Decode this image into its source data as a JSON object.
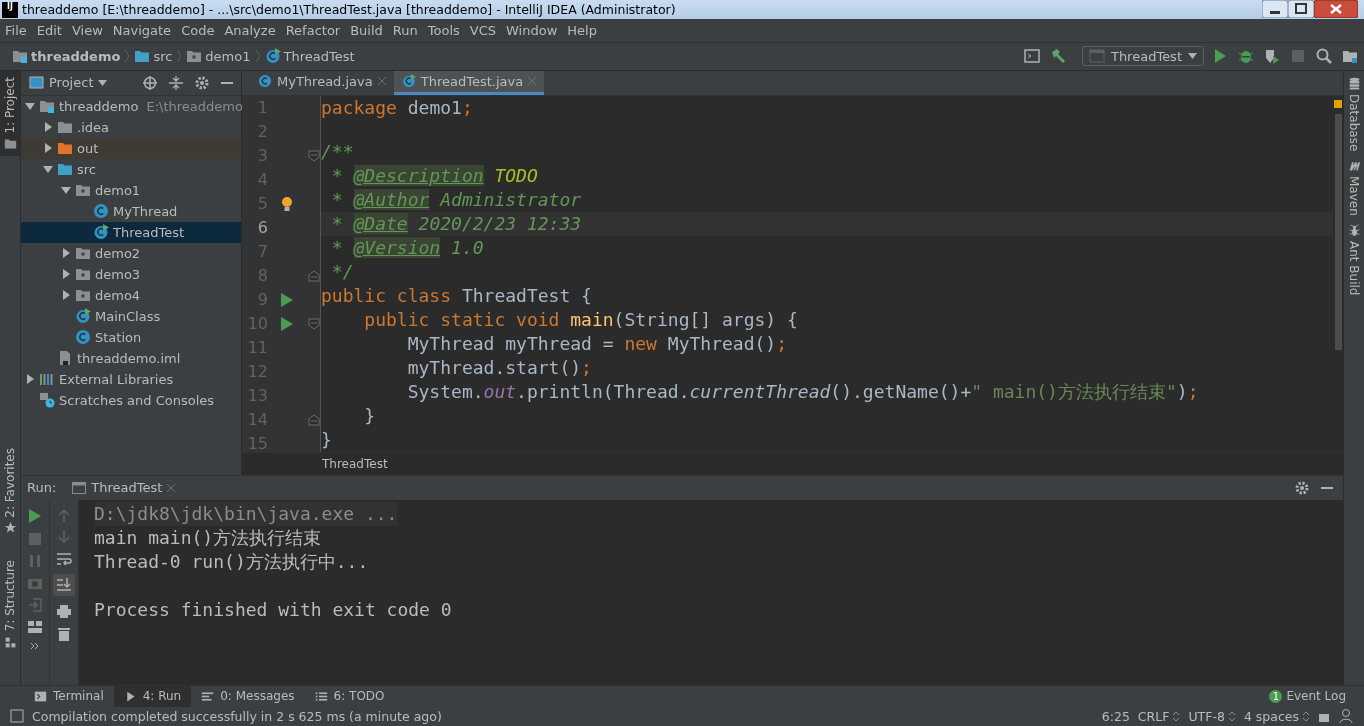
{
  "window": {
    "title": "threaddemo [E:\\threaddemo] - ...\\src\\demo1\\ThreadTest.java [threaddemo] - IntelliJ IDEA (Administrator)",
    "app_icon": "IJ"
  },
  "menu": [
    "File",
    "Edit",
    "View",
    "Navigate",
    "Code",
    "Analyze",
    "Refactor",
    "Build",
    "Run",
    "Tools",
    "VCS",
    "Window",
    "Help"
  ],
  "breadcrumbs": [
    {
      "label": "threaddemo",
      "kind": "module"
    },
    {
      "label": "src",
      "kind": "source-folder"
    },
    {
      "label": "demo1",
      "kind": "package"
    },
    {
      "label": "ThreadTest",
      "kind": "runnable-class"
    }
  ],
  "run_config": "ThreadTest",
  "left_stripe": {
    "top": [
      {
        "label": "1: Project",
        "kind": "folder",
        "selected": true
      }
    ],
    "bottom": [
      {
        "label": "2: Favorites",
        "kind": "star",
        "selected": false
      },
      {
        "label": "7: Structure",
        "kind": "structure",
        "selected": false
      }
    ]
  },
  "project_panel": {
    "title": "Project",
    "tree": [
      {
        "label": "threaddemo",
        "path": "E:\\threaddemo",
        "kind": "module",
        "expanded": true,
        "selected": false,
        "children": [
          {
            "label": ".idea",
            "kind": "folder",
            "expanded": false,
            "selected": false
          },
          {
            "label": "out",
            "kind": "excluded-folder",
            "expanded": false,
            "selected": false
          },
          {
            "label": "src",
            "kind": "source-folder",
            "expanded": true,
            "selected": false,
            "children": [
              {
                "label": "demo1",
                "kind": "package",
                "expanded": true,
                "selected": false,
                "children": [
                  {
                    "label": "MyThread",
                    "kind": "class",
                    "selected": false
                  },
                  {
                    "label": "ThreadTest",
                    "kind": "runnable-class",
                    "selected": true
                  }
                ]
              },
              {
                "label": "demo2",
                "kind": "package",
                "expanded": false,
                "selected": false
              },
              {
                "label": "demo3",
                "kind": "package",
                "expanded": false,
                "selected": false
              },
              {
                "label": "demo4",
                "kind": "package",
                "expanded": false,
                "selected": false
              },
              {
                "label": "MainClass",
                "kind": "runnable-class",
                "selected": false
              },
              {
                "label": "Station",
                "kind": "class",
                "selected": false
              }
            ]
          },
          {
            "label": "threaddemo.iml",
            "kind": "iml",
            "selected": false
          }
        ]
      },
      {
        "label": "External Libraries",
        "kind": "libraries",
        "expanded": false,
        "selected": false
      },
      {
        "label": "Scratches and Consoles",
        "kind": "scratches",
        "selected": false
      }
    ]
  },
  "editor": {
    "tabs": [
      {
        "label": "MyThread.java",
        "kind": "class",
        "selected": false
      },
      {
        "label": "ThreadTest.java",
        "kind": "runnable-class",
        "selected": true
      }
    ],
    "lines": [
      {
        "number": "1",
        "current": false,
        "run_marker": false,
        "bulb": false,
        "fold_start": false,
        "fold_end": false,
        "tokens": [
          {
            "kind": "keyword",
            "text": "package "
          },
          {
            "kind": "text",
            "text": "demo1"
          },
          {
            "kind": "keyword",
            "text": ";"
          }
        ]
      },
      {
        "number": "2",
        "current": false,
        "run_marker": false,
        "bulb": false,
        "fold_start": false,
        "fold_end": false
      },
      {
        "number": "3",
        "current": false,
        "run_marker": false,
        "bulb": false,
        "fold_start": true,
        "fold_end": false,
        "tokens": [
          {
            "kind": "doc",
            "text": "/**"
          }
        ]
      },
      {
        "number": "4",
        "current": false,
        "run_marker": false,
        "bulb": false,
        "fold_start": false,
        "fold_end": false,
        "tokens": [
          {
            "kind": "doc",
            "text": " * "
          },
          {
            "kind": "doc-tag",
            "text": "@Description"
          },
          {
            "kind": "todo",
            "text": " TODO"
          }
        ]
      },
      {
        "number": "5",
        "current": false,
        "run_marker": false,
        "bulb": true,
        "fold_start": false,
        "fold_end": false,
        "tokens": [
          {
            "kind": "doc",
            "text": " * "
          },
          {
            "kind": "doc-tag",
            "text": "@Author"
          },
          {
            "kind": "doc",
            "text": " Administrator"
          }
        ]
      },
      {
        "number": "6",
        "current": true,
        "run_marker": false,
        "bulb": false,
        "fold_start": false,
        "fold_end": false,
        "tokens": [
          {
            "kind": "doc",
            "text": " * "
          },
          {
            "kind": "doc-tag",
            "text": "@Date"
          },
          {
            "kind": "doc",
            "text": " 2020/2/23 12:33"
          }
        ]
      },
      {
        "number": "7",
        "current": false,
        "run_marker": false,
        "bulb": false,
        "fold_start": false,
        "fold_end": false,
        "tokens": [
          {
            "kind": "doc",
            "text": " * "
          },
          {
            "kind": "doc-tag",
            "text": "@Version"
          },
          {
            "kind": "doc",
            "text": " 1.0"
          }
        ]
      },
      {
        "number": "8",
        "current": false,
        "run_marker": false,
        "bulb": false,
        "fold_start": false,
        "fold_end": true,
        "tokens": [
          {
            "kind": "doc",
            "text": " */"
          }
        ]
      },
      {
        "number": "9",
        "current": false,
        "run_marker": true,
        "bulb": false,
        "fold_start": false,
        "fold_end": false,
        "tokens": [
          {
            "kind": "keyword",
            "text": "public class "
          },
          {
            "kind": "text",
            "text": "ThreadTest {"
          }
        ]
      },
      {
        "number": "10",
        "current": false,
        "run_marker": true,
        "bulb": false,
        "fold_start": true,
        "fold_end": false,
        "tokens": [
          {
            "kind": "keyword",
            "text": "    public static void "
          },
          {
            "kind": "method-decl",
            "text": "main"
          },
          {
            "kind": "text",
            "text": "(String[] args) {"
          }
        ]
      },
      {
        "number": "11",
        "current": false,
        "run_marker": false,
        "bulb": false,
        "fold_start": false,
        "fold_end": false,
        "tokens": [
          {
            "kind": "text",
            "text": "        MyThread myThread = "
          },
          {
            "kind": "keyword",
            "text": "new "
          },
          {
            "kind": "text",
            "text": "MyThread()"
          },
          {
            "kind": "keyword",
            "text": ";"
          }
        ]
      },
      {
        "number": "12",
        "current": false,
        "run_marker": false,
        "bulb": false,
        "fold_start": false,
        "fold_end": false,
        "tokens": [
          {
            "kind": "text",
            "text": "        myThread.start()"
          },
          {
            "kind": "keyword",
            "text": ";"
          }
        ]
      },
      {
        "number": "13",
        "current": false,
        "run_marker": false,
        "bulb": false,
        "fold_start": false,
        "fold_end": false,
        "tokens": [
          {
            "kind": "text",
            "text": "        System."
          },
          {
            "kind": "field",
            "text": "out"
          },
          {
            "kind": "text",
            "text": ".println(Thread."
          },
          {
            "kind": "static-call",
            "text": "currentThread"
          },
          {
            "kind": "text",
            "text": "().getName()+"
          },
          {
            "kind": "string",
            "text": "\" main()方法执行结束\""
          },
          {
            "kind": "text",
            "text": ")"
          },
          {
            "kind": "keyword",
            "text": ";"
          }
        ]
      },
      {
        "number": "14",
        "current": false,
        "run_marker": false,
        "bulb": false,
        "fold_start": false,
        "fold_end": true,
        "tokens": [
          {
            "kind": "text",
            "text": "    }"
          }
        ]
      },
      {
        "number": "15",
        "current": false,
        "run_marker": false,
        "bulb": false,
        "fold_start": false,
        "fold_end": false,
        "tokens": [
          {
            "kind": "text",
            "text": "}"
          }
        ]
      }
    ],
    "breadcrumb": "ThreadTest"
  },
  "right_stripe": [
    {
      "label": "Database",
      "kind": "database"
    },
    {
      "label": "Maven",
      "kind": "maven"
    },
    {
      "label": "Ant Build",
      "kind": "ant"
    }
  ],
  "run_panel": {
    "label": "Run:",
    "tab": "ThreadTest",
    "console": [
      {
        "kind": "command",
        "text": "D:\\jdk8\\jdk\\bin\\java.exe ..."
      },
      {
        "kind": "output",
        "text": "main main()方法执行结束"
      },
      {
        "kind": "output",
        "text": "Thread-0 run()方法执行中..."
      },
      {
        "kind": "exit",
        "text": "Process finished with exit code 0"
      }
    ]
  },
  "tool_tabs": [
    {
      "label": "Terminal",
      "kind": "terminal",
      "selected": false
    },
    {
      "label": "4: Run",
      "kind": "run",
      "selected": true
    },
    {
      "label": "0: Messages",
      "kind": "messages",
      "selected": false
    },
    {
      "label": "6: TODO",
      "kind": "todo",
      "selected": false
    }
  ],
  "status_bar": {
    "message": "Compilation completed successfully in 2 s 625 ms (a minute ago)",
    "caret": "6:25",
    "line_separator": "CRLF",
    "encoding": "UTF-8",
    "indent": "4 spaces",
    "event_log": {
      "label": "Event Log",
      "count": "1"
    }
  }
}
